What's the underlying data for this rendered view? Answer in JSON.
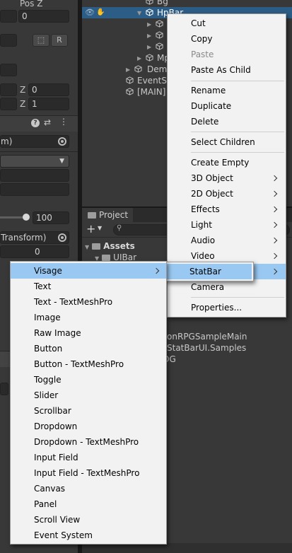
{
  "inspector": {
    "pos_z_label": "Pos Z",
    "pos_z_value": "0",
    "r_button": "R",
    "scale_z_label": "Z",
    "scale_z_value": "0",
    "z2_label": "Z",
    "z2_value": "1",
    "field_m": "m)",
    "slider_value": "100",
    "transform_label": "Transform)",
    "value_zero": "0"
  },
  "hierarchy": {
    "rows": [
      {
        "label": "Bg"
      },
      {
        "label": "HpBar"
      },
      {
        "label": ""
      },
      {
        "label": ""
      },
      {
        "label": ""
      },
      {
        "label": "Mp"
      },
      {
        "label": "Demo"
      },
      {
        "label": "EventS"
      },
      {
        "label": "[MAIN]"
      }
    ]
  },
  "project": {
    "tab_label": "Project",
    "add_label": "+",
    "assets_label": "Assets",
    "uibar_label": "UIBar",
    "items": [
      "s",
      "tionRPGSampleMain",
      "StatBarUI.Samples",
      "OG"
    ]
  },
  "context_menu": {
    "items": [
      {
        "label": "Cut",
        "enabled": true
      },
      {
        "label": "Copy",
        "enabled": true
      },
      {
        "label": "Paste",
        "enabled": false
      },
      {
        "label": "Paste As Child",
        "enabled": true
      },
      {
        "label": "Rename",
        "enabled": true
      },
      {
        "label": "Duplicate",
        "enabled": true
      },
      {
        "label": "Delete",
        "enabled": true
      },
      {
        "label": "Select Children",
        "enabled": true
      },
      {
        "label": "Create Empty",
        "enabled": true
      },
      {
        "label": "3D Object",
        "submenu": true
      },
      {
        "label": "2D Object",
        "submenu": true
      },
      {
        "label": "Effects",
        "submenu": true
      },
      {
        "label": "Light",
        "submenu": true
      },
      {
        "label": "Audio",
        "submenu": true
      },
      {
        "label": "Video",
        "submenu": true
      },
      {
        "label": "StatBar",
        "submenu": true,
        "highlighted": true
      },
      {
        "label": "Camera"
      },
      {
        "label": "Properties..."
      }
    ]
  },
  "ui_submenu": {
    "items": [
      {
        "label": "Visage",
        "submenu": true,
        "highlighted": true
      },
      {
        "label": "Text"
      },
      {
        "label": "Text - TextMeshPro"
      },
      {
        "label": "Image"
      },
      {
        "label": "Raw Image"
      },
      {
        "label": "Button"
      },
      {
        "label": "Button - TextMeshPro"
      },
      {
        "label": "Toggle"
      },
      {
        "label": "Slider"
      },
      {
        "label": "Scrollbar"
      },
      {
        "label": "Dropdown"
      },
      {
        "label": "Dropdown - TextMeshPro"
      },
      {
        "label": "Input Field"
      },
      {
        "label": "Input Field - TextMeshPro"
      },
      {
        "label": "Canvas"
      },
      {
        "label": "Panel"
      },
      {
        "label": "Scroll View"
      },
      {
        "label": "Event System"
      }
    ]
  },
  "colors": {
    "selection": "#2c5d87",
    "menu_highlight": "#99c9f2",
    "menu_bg": "#f2f2f2",
    "editor_bg": "#383838"
  }
}
